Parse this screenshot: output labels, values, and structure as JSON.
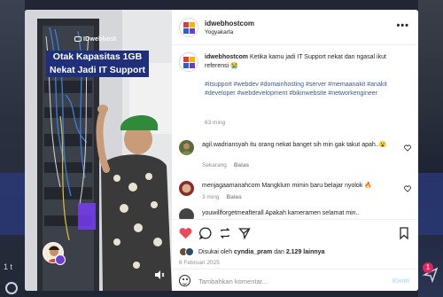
{
  "colors": {
    "accent": "#0095f6",
    "link": "#385898",
    "like": "#ed4956",
    "caption_bg": "#1f2f7a"
  },
  "background": {
    "left_text": "1 t",
    "badge_count": "1"
  },
  "media": {
    "watermark": "IDwebhost",
    "caption_lines": [
      "Otak Kapasitas 1GB",
      "Nekat Jadi IT Support"
    ],
    "mute_icon": "speaker-icon"
  },
  "header": {
    "username": "idwebhostcom",
    "location": "Yogyakarta",
    "more_label": "•••"
  },
  "post": {
    "username": "idwebhostcom",
    "text": "Ketika kamu jadi IT Support nekat dan ngasal ikut referensi 😭",
    "hashtags": "#itsupport #webdev #domainhosting #server #memaanakit #anakit #developer #webdevelopment #bikinwebsite #networkengineer",
    "time": "63 ming"
  },
  "comments": [
    {
      "username": "agil.wadriansyah",
      "text": "itu orang nekat banget sih min gak takut apah..😮",
      "time": "Sekarang",
      "reply": "Balas"
    },
    {
      "username": "menjagaamanahcom",
      "text": "Mangklum mimin baru belajar nyolok 🔥",
      "time": "3 ming",
      "reply": "Balas"
    },
    {
      "username": "youwillforgetmeafterall",
      "text": "Apakah kameramen selamat min..",
      "time": "",
      "reply": ""
    }
  ],
  "likes": {
    "prefix": "Disukai oleh",
    "user": "cyndia_pram",
    "joiner": "dan",
    "count": "2.129 lainnya"
  },
  "date": "6 Februari 2025",
  "comment_box": {
    "placeholder": "Tambahkan komentar...",
    "send_label": "Kirim"
  }
}
